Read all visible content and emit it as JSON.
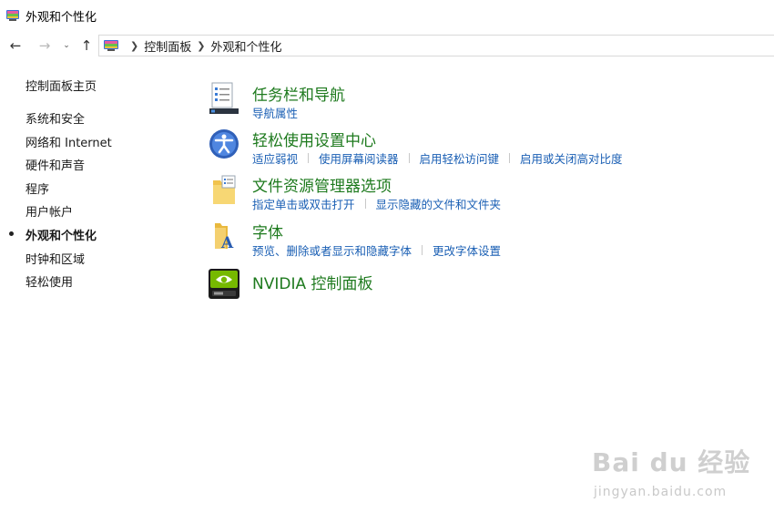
{
  "window": {
    "title": "外观和个性化"
  },
  "navigation": {
    "back_icon": "arrow-left-icon",
    "forward_icon": "arrow-right-icon",
    "recent_icon": "chevron-down-icon",
    "up_icon": "arrow-up-icon",
    "breadcrumbs": [
      "控制面板",
      "外观和个性化"
    ]
  },
  "sidebar": {
    "home": "控制面板主页",
    "items": [
      {
        "label": "系统和安全"
      },
      {
        "label": "网络和 Internet"
      },
      {
        "label": "硬件和声音"
      },
      {
        "label": "程序"
      },
      {
        "label": "用户帐户"
      },
      {
        "label": "外观和个性化"
      },
      {
        "label": "时钟和区域"
      },
      {
        "label": "轻松使用"
      }
    ]
  },
  "categories": [
    {
      "title": "任务栏和导航",
      "icon": "taskbar-icon",
      "links": [
        "导航属性"
      ]
    },
    {
      "title": "轻松使用设置中心",
      "icon": "ease-of-access-icon",
      "links": [
        "适应弱视",
        "使用屏幕阅读器",
        "启用轻松访问键",
        "启用或关闭高对比度"
      ]
    },
    {
      "title": "文件资源管理器选项",
      "icon": "folder-options-icon",
      "links": [
        "指定单击或双击打开",
        "显示隐藏的文件和文件夹"
      ]
    },
    {
      "title": "字体",
      "icon": "fonts-folder-icon",
      "links": [
        "预览、删除或者显示和隐藏字体",
        "更改字体设置"
      ]
    },
    {
      "title": "NVIDIA 控制面板",
      "icon": "nvidia-icon",
      "links": []
    }
  ],
  "watermark": {
    "main": "Bai du 经验",
    "sub": "jingyan.baidu.com"
  },
  "colors": {
    "category_title": "#1e7a1e",
    "link": "#1a5fb4",
    "nvidia_green": "#76b900"
  }
}
